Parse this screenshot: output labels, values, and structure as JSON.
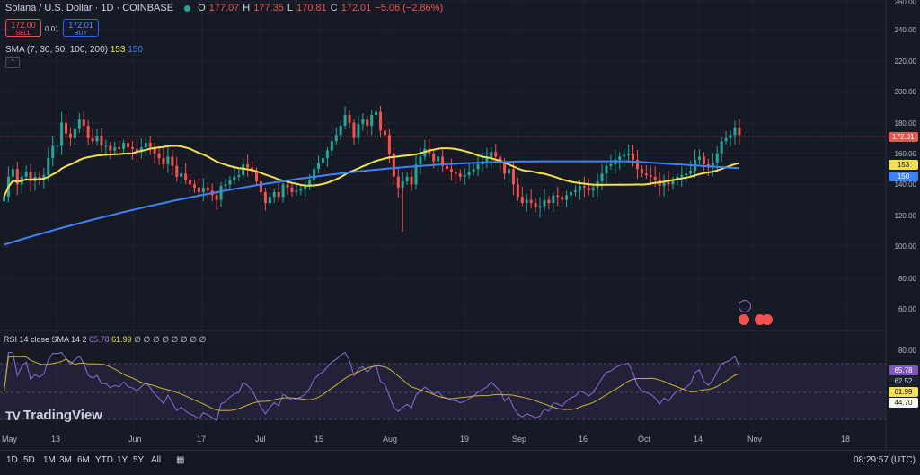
{
  "header": {
    "symbol_title": "Solana / U.S. Dollar · 1D · COINBASE",
    "open_label": "O",
    "open": "177.07",
    "high_label": "H",
    "high": "177.35",
    "low_label": "L",
    "low": "170.81",
    "close_label": "C",
    "close": "172.01",
    "change": "−5.06 (−2.86%)"
  },
  "trade": {
    "sell_price": "172.00",
    "sell_label": "SELL",
    "spread": "0.01",
    "buy_price": "172.01",
    "buy_label": "BUY"
  },
  "indicators": {
    "sma_label": "SMA (7, 30, 50, 100, 200)",
    "sma_val1": "153",
    "sma_val2": "150",
    "rsi_label": "RSI 14 close SMA 14 2",
    "rsi_val": "65.78",
    "rsi_sma_val": "61.99",
    "rsi_placeholders": "∅ ∅ ∅ ∅ ∅ ∅ ∅ ∅"
  },
  "price_axis": [
    "260.00",
    "240.00",
    "220.00",
    "200.00",
    "180.00",
    "160.00",
    "140.00",
    "120.00",
    "100.00",
    "80.00",
    "60.00"
  ],
  "price_tags": {
    "last": "172.01",
    "sma_yellow": "153",
    "sma_blue": "150"
  },
  "rsi_axis": [
    "80.00",
    "40.00"
  ],
  "rsi_tags": {
    "rsi": "65.78",
    "upper_level": "62.52",
    "rsi_sma": "61.99",
    "lower_level": "44.70"
  },
  "x_axis": [
    "May",
    "13",
    "Jun",
    "17",
    "Jul",
    "15",
    "Aug",
    "19",
    "Sep",
    "16",
    "Oct",
    "14",
    "Nov",
    "18"
  ],
  "branding": {
    "logo_text": "TradingView"
  },
  "timeframes": [
    "1D",
    "5D",
    "1M",
    "3M",
    "6M",
    "YTD",
    "1Y",
    "5Y",
    "All"
  ],
  "clock": "08:29:57 (UTC)",
  "colors": {
    "up": "#26a69a",
    "down": "#ef5350",
    "sma_yellow": "#f4e04d",
    "sma_blue": "#3f82f7",
    "rsi": "#8e6bd8",
    "bg": "#161a25"
  },
  "chart_data": {
    "type": "candlestick",
    "y_axis_range": [
      50,
      265
    ],
    "rsi_range": [
      25,
      90
    ],
    "closes": [
      132,
      145,
      150,
      140,
      145,
      148,
      142,
      145,
      144,
      146,
      157,
      165,
      165,
      180,
      173,
      170,
      176,
      182,
      178,
      170,
      168,
      171,
      165,
      165,
      162,
      164,
      163,
      167,
      164,
      163,
      161,
      164,
      167,
      164,
      160,
      157,
      153,
      158,
      152,
      145,
      147,
      143,
      140,
      138,
      135,
      138,
      136,
      133,
      130,
      139,
      140,
      143,
      145,
      146,
      153,
      151,
      148,
      142,
      135,
      128,
      132,
      135,
      132,
      140,
      138,
      135,
      136,
      137,
      139,
      143,
      150,
      154,
      157,
      162,
      168,
      172,
      178,
      185,
      180,
      170,
      179,
      182,
      178,
      185,
      187,
      175,
      172,
      160,
      145,
      138,
      142,
      145,
      140,
      153,
      158,
      163,
      160,
      155,
      158,
      152,
      150,
      148,
      147,
      145,
      146,
      148,
      150,
      153,
      155,
      157,
      161,
      158,
      155,
      147,
      150,
      140,
      132,
      128,
      130,
      128,
      125,
      126,
      130,
      128,
      133,
      132,
      130,
      133,
      135,
      136,
      139,
      138,
      136,
      138,
      142,
      147,
      152,
      153,
      156,
      158,
      159,
      160,
      156,
      150,
      147,
      146,
      145,
      143,
      139,
      142,
      140,
      143,
      145,
      146,
      147,
      149,
      156,
      158,
      153,
      151,
      154,
      160,
      168,
      170,
      172,
      177,
      172
    ]
  }
}
